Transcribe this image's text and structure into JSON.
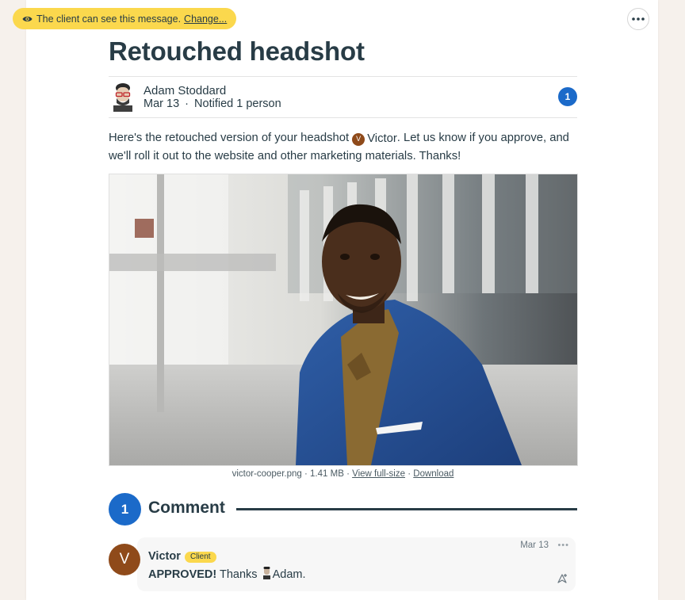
{
  "visibility_notice": {
    "text": "The client can see this message.",
    "change_label": "Change..."
  },
  "page": {
    "title": "Retouched headshot"
  },
  "author": {
    "name": "Adam Stoddard",
    "date": "Mar 13",
    "notified": "Notified 1 person",
    "separator": "·"
  },
  "comment_count_badge": "1",
  "message": {
    "before_mention": "Here's the retouched version of your headshot",
    "mention_initial": "V",
    "mention_name": "Victor",
    "after_mention": ". Let us know if you approve, and we'll roll it out to the website and other marketing materials. Thanks!"
  },
  "attachment": {
    "filename": "victor-cooper.png",
    "size": "1.41 MB",
    "view_label": "View full-size",
    "download_label": "Download",
    "sep": "·"
  },
  "comments_section": {
    "count": "1",
    "heading": "Comment"
  },
  "comment": {
    "avatar_initial": "V",
    "author": "Victor",
    "badge": "Client",
    "date": "Mar 13",
    "more": "•••",
    "bold_text": "APPROVED!",
    "text_before_mention": " Thanks",
    "mention_name": "Adam."
  },
  "colors": {
    "accent_blue": "#1b6ac9",
    "notice_yellow": "#fbd84d",
    "text_dark": "#283c46",
    "avatar_brown": "#8f4a1a"
  },
  "icons": [
    "eye-icon",
    "more-options-icon",
    "boost-icon"
  ]
}
